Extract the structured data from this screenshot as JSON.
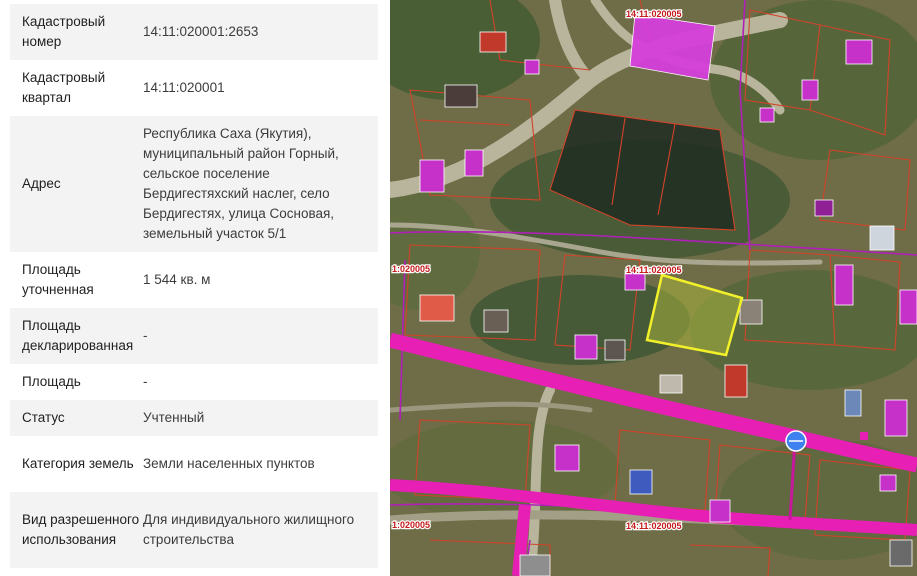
{
  "details": {
    "rows": [
      {
        "label": "Кадастровый номер",
        "value": "14:11:020001:2653"
      },
      {
        "label": "Кадастровый квартал",
        "value": "14:11:020001"
      },
      {
        "label": "Адрес",
        "value": "Республика Саха (Якутия), муниципальный район Горный, сельское поселение Бердигестяхский наслег, село Бердигестях, улица Сосновая, земельный участок 5/1"
      },
      {
        "label": "Площадь уточненная",
        "value": "1 544 кв. м"
      },
      {
        "label": "Площадь декларированная",
        "value": "-"
      },
      {
        "label": "Площадь",
        "value": "-"
      },
      {
        "label": "Статус",
        "value": "Учтенный"
      },
      {
        "label": "Категория земель",
        "value": "Земли населенных пунктов"
      },
      {
        "label": "Вид разрешенного использования",
        "value": "Для индивидуального жилищного строительства"
      }
    ]
  },
  "map": {
    "labels": {
      "top": "14:11:020005",
      "middle": "14:11:020005",
      "left_middle": "1:020005",
      "left_bottom": "1:020005",
      "bottom": "14:11:020005"
    },
    "colors": {
      "road_pink": "#e81fb4",
      "parcel_outline": "#d2432a",
      "selected_parcel": "#f1f02a",
      "marker": "#3f82ef"
    }
  }
}
